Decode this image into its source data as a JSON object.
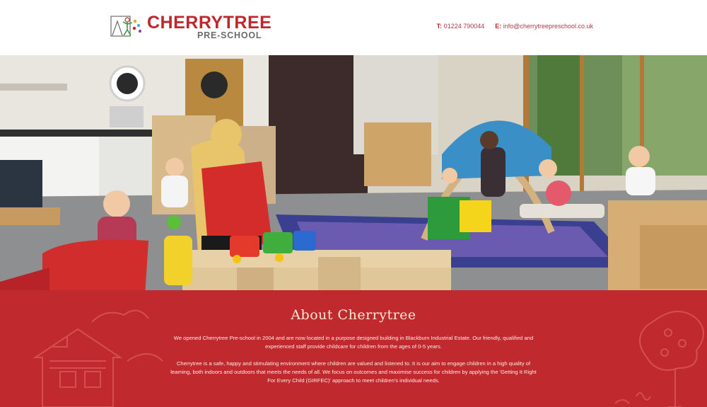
{
  "brand": {
    "logo_main": "CHERRYTREE",
    "logo_sub": "PRE-SCHOOL",
    "logo_icon": "cherrytree-logo-icon",
    "colors": {
      "primary": "#c0272d",
      "section_bg": "#c02a2e",
      "title": "#f6ead6",
      "grey": "#6b6b6b"
    }
  },
  "header": {
    "phone_label": "T:",
    "phone_value": "01224 790044",
    "email_label": "E:",
    "email_value": "info@cherrytreepreschool.co.uk"
  },
  "slider": {
    "dots": 4,
    "active_index": 1
  },
  "about": {
    "title": "About Cherrytree",
    "paragraph1": "We opened Cherrytree Pre-school in 2004 and are now located in a purpose designed building in Blackburn Industrial Estate. Our friendly, qualified and experienced staff provide childcare for children from the ages of 0-5 years.",
    "paragraph2": "Cherrytree is a safe, happy and stimulating environment where children are valued and listened to. It is our aim to engage children in a high quality of learning, both indoors and outdoors that meets the needs of all. We focus on outcomes and maximise success for children by applying the 'Getting It Right For Every Child (GIRFEC)' approach to meet children's individual needs."
  }
}
